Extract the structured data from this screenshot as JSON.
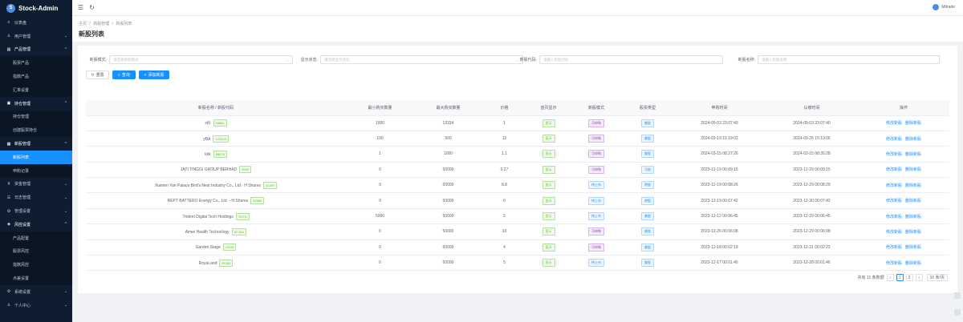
{
  "app": {
    "title": "Stock-Admin",
    "logo_glyph": "S"
  },
  "sidebar": {
    "items": [
      {
        "label": "仪表盘",
        "icon": "≡",
        "kind": "group"
      },
      {
        "label": "用户管理",
        "icon": "♙",
        "kind": "group",
        "arrow": "⌄"
      },
      {
        "label": "产品管理",
        "icon": "▤",
        "kind": "group open",
        "arrow": "⌃"
      },
      {
        "label": "股票产品",
        "kind": "sub"
      },
      {
        "label": "指数产品",
        "kind": "sub"
      },
      {
        "label": "汇率设置",
        "kind": "sub"
      },
      {
        "label": "持仓管理",
        "icon": "▣",
        "kind": "group open",
        "arrow": "⌃"
      },
      {
        "label": "持仓管理",
        "kind": "sub"
      },
      {
        "label": "创建股票持仓",
        "kind": "sub"
      },
      {
        "label": "新股管理",
        "icon": "▦",
        "kind": "group open",
        "arrow": "⌃"
      },
      {
        "label": "新股列表",
        "kind": "sub active"
      },
      {
        "label": "申购记录",
        "kind": "sub"
      },
      {
        "label": "资金管理",
        "icon": "¥",
        "kind": "group",
        "arrow": "⌄"
      },
      {
        "label": "日志管理",
        "icon": "☰",
        "kind": "group",
        "arrow": "⌄"
      },
      {
        "label": "管理设置",
        "icon": "⚙",
        "kind": "group",
        "arrow": "⌄"
      },
      {
        "label": "风控设置",
        "icon": "◈",
        "kind": "group open",
        "arrow": "⌃"
      },
      {
        "label": "产品配置",
        "kind": "sub"
      },
      {
        "label": "股票风控",
        "kind": "sub"
      },
      {
        "label": "指数风控",
        "kind": "sub"
      },
      {
        "label": "点差设置",
        "kind": "sub"
      },
      {
        "label": "系统设置",
        "icon": "⚙",
        "kind": "group",
        "arrow": "⌄"
      },
      {
        "label": "个人中心",
        "icon": "♙",
        "kind": "group",
        "arrow": "⌄"
      }
    ]
  },
  "topbar": {
    "menu_icon": "☰",
    "refresh_icon": "↻",
    "user": "Mitrade"
  },
  "breadcrumb": {
    "items": [
      "主页",
      "新股管理",
      "新股列表"
    ],
    "sep": "/"
  },
  "page": {
    "title": "新股列表"
  },
  "filters": {
    "mode": {
      "label": "新股模式:",
      "placeholder": "请选择新股模式"
    },
    "display": {
      "label": "显示状态:",
      "placeholder": "请选择显示状态"
    },
    "code": {
      "label": "新股代码:",
      "placeholder": "请输入新股代码"
    },
    "name": {
      "label": "新股名称:",
      "placeholder": "请输入新股名称"
    },
    "select_arrow": "⌄"
  },
  "buttons": {
    "reset": "重置",
    "search": "查询",
    "add": "添加新股",
    "reset_icon": "↻",
    "search_icon": "⌕",
    "add_icon": "+"
  },
  "table": {
    "headers": [
      "新股名称 / 新股代码",
      "最小购买数量",
      "最大购买数量",
      "价格",
      "首页显示",
      "新股模式",
      "股票类型",
      "申购时间",
      "认缴时间",
      "操作"
    ],
    "rows": [
      {
        "name": "sKt",
        "code": "39861",
        "min": "1000",
        "max": "13324",
        "price": "1",
        "show": "显示",
        "mode": "可申购",
        "type": "美股",
        "apply": "2024-05-03 23:07:40",
        "sub": "2024-05-03 23:07:40"
      },
      {
        "name": "yBA",
        "code": "123413",
        "min": "100",
        "max": "500",
        "price": "12",
        "show": "显示",
        "mode": "可申购",
        "type": "美股",
        "apply": "2024-03-19 15:19:02",
        "sub": "2024-03-26 15:19:06"
      },
      {
        "name": "kkk",
        "code": "68678",
        "min": "1",
        "max": "1000",
        "price": "1.1",
        "show": "显示",
        "mode": "可申购",
        "type": "美股",
        "apply": "2024-03-15 08:27:26",
        "sub": "2024-03-15 08:35:28"
      },
      {
        "name": "JATI TINGGI GROUP BERHAD",
        "code": "0292",
        "min": "0",
        "max": "50000",
        "price": "0.27",
        "show": "显示",
        "mode": "可申购",
        "type": "马股",
        "apply": "2023-12-19 00:09:15",
        "sub": "2023-12-29 00:09:15"
      },
      {
        "name": "Xiamen Yan Palace Bird's Nest Industry Co., Ltd.- H Shares",
        "code": "01497",
        "min": "0",
        "max": "50000",
        "price": "8.8",
        "show": "显示",
        "mode": "待上市",
        "type": "港股",
        "apply": "2023-12-19 00:08:26",
        "sub": "2023-12-29 00:08:29"
      },
      {
        "name": "REPT BATTERO Energy Co., Ltd. - H Shares",
        "code": "00666",
        "min": "0",
        "max": "50000",
        "price": "0",
        "show": "显示",
        "mode": "待上市",
        "type": "港股",
        "apply": "2023-12-19 00:07:42",
        "sub": "2023-12-30 00:07:42"
      },
      {
        "name": "Trident Digital Tech Holdings",
        "code": "TDTH",
        "min": "5000",
        "max": "50000",
        "price": "5",
        "show": "显示",
        "mode": "待上市",
        "type": "美股",
        "apply": "2023-12-12 00:06:45",
        "sub": "2023-12-29 00:06:45"
      },
      {
        "name": "Aimei Health Technology",
        "code": "AFJKU",
        "min": "0",
        "max": "50000",
        "price": "10",
        "show": "显示",
        "mode": "可申购",
        "type": "美股",
        "apply": "2023-12-26 00:06:08",
        "sub": "2023-12-29 00:06:08"
      },
      {
        "name": "Garden Stage",
        "code": "GSIW",
        "min": "0",
        "max": "50000",
        "price": "4",
        "show": "显示",
        "mode": "可申购",
        "type": "美股",
        "apply": "2023-12-18 00:02:19",
        "sub": "2023-12-31 00:02:22"
      },
      {
        "name": "RoyaLand",
        "code": "RLND",
        "min": "0",
        "max": "50000",
        "price": "5",
        "show": "显示",
        "mode": "待上市",
        "type": "美股",
        "apply": "2023-12-17 00:01:46",
        "sub": "2023-12-28 00:01:46"
      }
    ],
    "edit_label": "修改新股",
    "delete_label": "删除新股"
  },
  "pagination": {
    "total_text": "共有 11 条数据",
    "prev": "‹",
    "next": "›",
    "pages": [
      "1",
      "2"
    ],
    "current": "1",
    "size": "10 条/页"
  },
  "colors": {
    "primary": "#1890ff",
    "sidebar_bg": "#0f1d30"
  }
}
